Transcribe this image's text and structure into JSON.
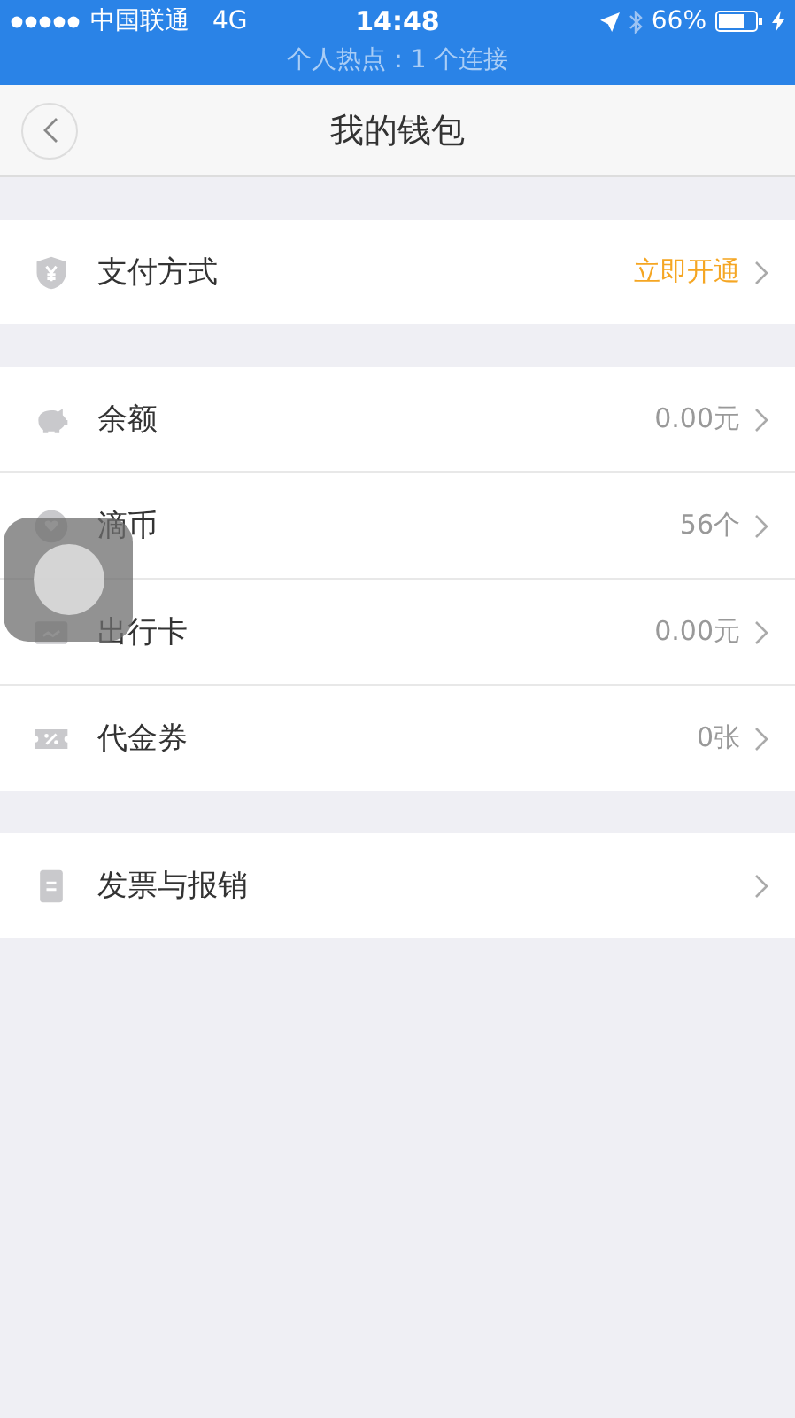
{
  "status_bar": {
    "carrier": "中国联通",
    "network": "4G",
    "time": "14:48",
    "battery": "66%",
    "hotspot": "个人热点：1 个连接"
  },
  "nav_bar": {
    "title": "我的钱包"
  },
  "sections": [
    {
      "rows": [
        {
          "label": "支付方式",
          "value": "立即开通",
          "kind": "action"
        }
      ]
    },
    {
      "rows": [
        {
          "label": "余额",
          "value": "0.00元",
          "kind": "value"
        },
        {
          "label": "滴币",
          "value": "56个",
          "kind": "value"
        },
        {
          "label": "出行卡",
          "value": "0.00元",
          "kind": "value"
        },
        {
          "label": "代金券",
          "value": "0张",
          "kind": "value"
        }
      ]
    },
    {
      "rows": [
        {
          "label": "发票与报销",
          "kind": "plain"
        }
      ]
    }
  ]
}
